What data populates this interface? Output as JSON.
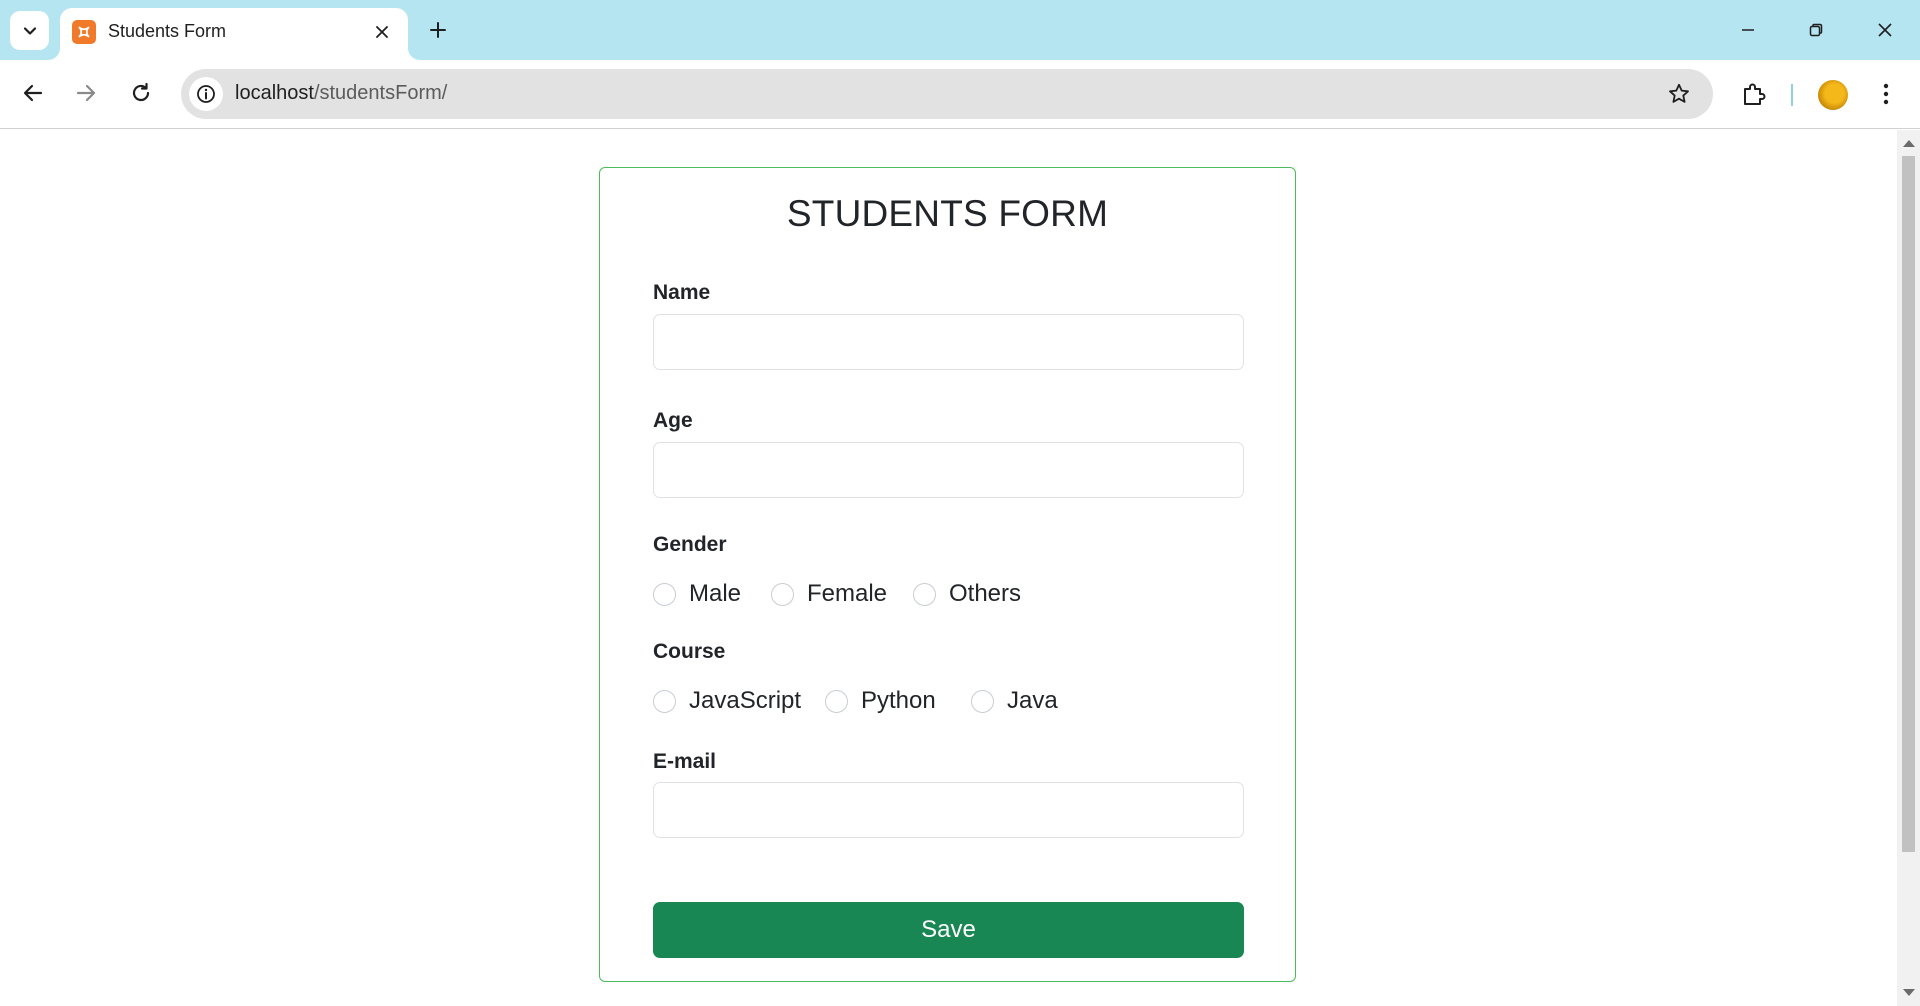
{
  "browser": {
    "tab": {
      "title": "Students Form",
      "favicon": "xampp-icon"
    },
    "address_bar": {
      "host": "localhost",
      "path": "/studentsForm/"
    }
  },
  "form": {
    "title": "STUDENTS FORM",
    "name": {
      "label": "Name",
      "value": "",
      "placeholder": ""
    },
    "age": {
      "label": "Age",
      "value": "",
      "placeholder": ""
    },
    "gender": {
      "label": "Gender",
      "options": [
        "Male",
        "Female",
        "Others"
      ],
      "selected": null
    },
    "course": {
      "label": "Course",
      "options": [
        "JavaScript",
        "Python",
        "Java"
      ],
      "selected": null
    },
    "email": {
      "label": "E-mail",
      "value": "",
      "placeholder": ""
    },
    "save_label": "Save"
  },
  "colors": {
    "tabstrip": "#b4e5f0",
    "card_border": "#4cbb5b",
    "save_button": "#198754",
    "favicon": "#f07a2a"
  }
}
